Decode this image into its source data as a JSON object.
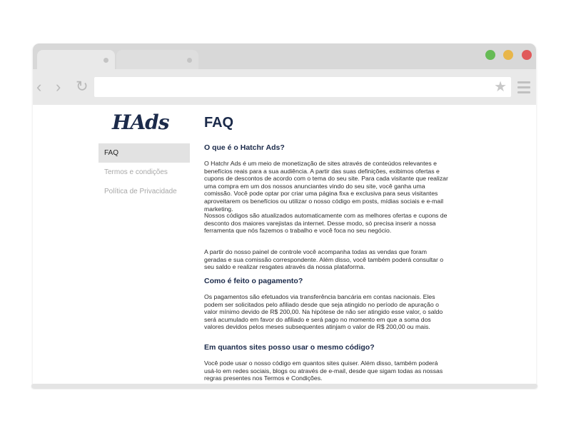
{
  "browser": {
    "window_controls": {
      "green": "#66bb55",
      "yellow": "#e8b64a",
      "red": "#e0595a"
    },
    "icons": {
      "back": "chevron-left-icon",
      "forward": "chevron-right-icon",
      "reload": "reload-icon",
      "bookmark": "star-icon",
      "menu": "hamburger-menu-icon"
    }
  },
  "site": {
    "logo": "HAds",
    "brand_color": "#1b2a4a",
    "sidebar": {
      "items": [
        {
          "label": "FAQ",
          "active": true
        },
        {
          "label": "Termos e condições",
          "active": false
        },
        {
          "label": "Política de Privacidade",
          "active": false
        }
      ]
    },
    "main": {
      "title": "FAQ",
      "sections": [
        {
          "question": "O que é o Hatchr Ads?",
          "paragraphs": [
            "O Hatchr Ads é um meio de monetização de sites através de conteúdos relevantes e benefícios reais para a sua audiência. A partir das suas definições, exibimos ofertas e cupons de descontos de acordo com o tema do seu site. Para cada visitante que realizar uma compra em um dos nossos anunciantes vindo do seu site, você ganha uma comissão. Você pode optar por criar uma página fixa e exclusiva para seus visitantes aproveitarem os benefícios ou utilizar o nosso código em posts, mídias sociais e e-mail marketing.",
            "Nossos códigos são atualizados automaticamente com as melhores ofertas e cupons de desconto dos maiores varejistas da internet. Desse modo, só precisa inserir a nossa ferramenta que nós fazemos o trabalho e você foca no seu negócio.",
            "A partir do nosso painel de controle você acompanha todas as vendas que foram geradas e sua comissão correspondente. Além disso, você também poderá consultar o seu saldo e realizar resgates através da nossa plataforma."
          ]
        },
        {
          "question": "Como é feito o pagamento?",
          "paragraphs": [
            "Os pagamentos são efetuados via transferência bancária em contas nacionais. Eles podem ser solicitados pelo afiliado desde que seja atingido no período de apuração o valor mínimo devido de R$ 200,00. Na hipótese de não ser atingido esse valor, o saldo será acumulado em favor do afiliado e será pago no momento em que a soma dos valores devidos pelos meses subsequentes atinjam o valor de R$ 200,00 ou mais."
          ]
        },
        {
          "question": "Em quantos sites posso usar o mesmo código?",
          "paragraphs": [
            "Você pode usar o nosso código em quantos sites quiser. Além disso, também poderá usá-lo em redes sociais, blogs ou através de e-mail, desde que sigam todas as nossas regras presentes nos Termos e Condições."
          ]
        }
      ]
    }
  }
}
